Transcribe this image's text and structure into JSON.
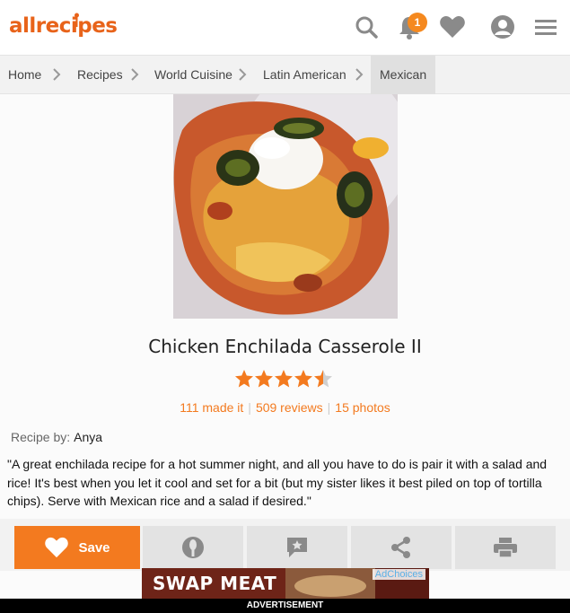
{
  "header": {
    "logo": "allrecipes",
    "notification_count": "1",
    "icons": [
      "search-icon",
      "bell-icon",
      "heart-icon",
      "user-icon",
      "menu-icon"
    ]
  },
  "breadcrumb": [
    "Home",
    "Recipes",
    "World Cuisine",
    "Latin American",
    "Mexican"
  ],
  "recipe": {
    "title": "Chicken Enchilada Casserole II",
    "rating": 4.5,
    "made_it": "111 made it",
    "reviews": "509 reviews",
    "photos": "15 photos",
    "by_label": "Recipe by:",
    "author": "Anya",
    "description": "\"A great enchilada recipe for a hot summer night, and all you have to do is pair it with a salad and rice! It's best when you let it cool and set for a bit (but my sister likes it best piled on top of tortilla chips). Serve with Mexican rice and a salad if desired.\""
  },
  "actions": {
    "save_label": "Save",
    "icons": [
      "heart-icon",
      "made-it-icon",
      "review-icon",
      "share-icon",
      "print-icon"
    ]
  },
  "ad": {
    "text": "SWAP MEAT",
    "choices": "AdChoices",
    "label": "ADVERTISEMENT"
  },
  "colors": {
    "brand": "#e8631a",
    "accent": "#f37a1f",
    "star": "#f37a1f"
  }
}
